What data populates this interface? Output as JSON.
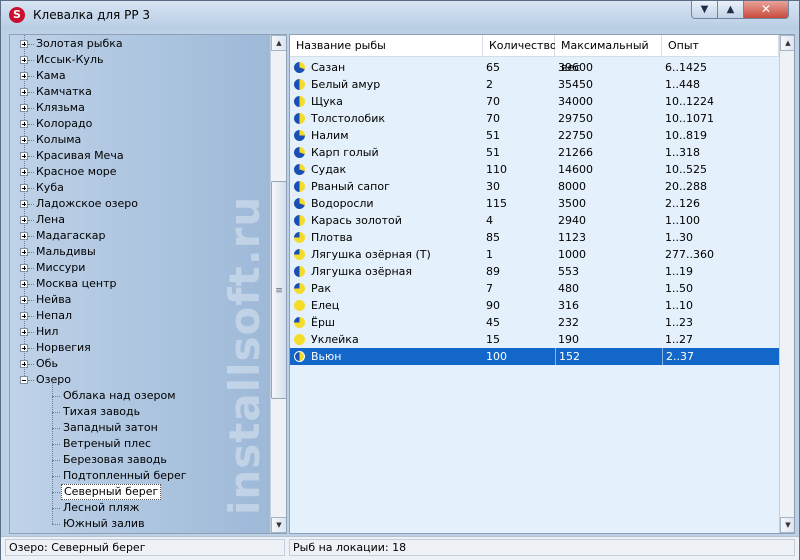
{
  "window": {
    "title": "Клевалка для РР 3",
    "app_icon_letter": "S"
  },
  "watermark": "installsoft.ru",
  "tree": {
    "lakes": [
      "Золотая рыбка",
      "Иссык-Куль",
      "Кама",
      "Камчатка",
      "Клязьма",
      "Колорадо",
      "Колыма",
      "Красивая Меча",
      "Красное море",
      "Куба",
      "Ладожское озеро",
      "Лена",
      "Мадагаскар",
      "Мальдивы",
      "Миссури",
      "Москва центр",
      "Нейва",
      "Непал",
      "Нил",
      "Норвегия",
      "Обь",
      "Озеро"
    ],
    "expanded_children": [
      "Облака над озером",
      "Тихая заводь",
      "Западный затон",
      "Ветреный плес",
      "Березовая заводь",
      "Подтопленный берег",
      "Северный берег",
      "Лесной пляж",
      "Южный залив"
    ],
    "selected": "Северный берег"
  },
  "table": {
    "columns": [
      "Название рыбы",
      "Количество",
      "Максимальный вес",
      "Опыт"
    ],
    "rows": [
      {
        "name": "Сазан",
        "count": "65",
        "max": "39600",
        "exp": "6..1425",
        "icon": "clock-3q"
      },
      {
        "name": "Белый амур",
        "count": "2",
        "max": "35450",
        "exp": "1..448",
        "icon": "clock-half"
      },
      {
        "name": "Щука",
        "count": "70",
        "max": "34000",
        "exp": "10..1224",
        "icon": "clock-half"
      },
      {
        "name": "Толстолобик",
        "count": "70",
        "max": "29750",
        "exp": "10..1071",
        "icon": "clock-half"
      },
      {
        "name": "Налим",
        "count": "51",
        "max": "22750",
        "exp": "10..819",
        "icon": "clock-full"
      },
      {
        "name": "Карп голый",
        "count": "51",
        "max": "21266",
        "exp": "1..318",
        "icon": "clock-3q"
      },
      {
        "name": "Судак",
        "count": "110",
        "max": "14600",
        "exp": "10..525",
        "icon": "clock-3q"
      },
      {
        "name": "Рваный сапог",
        "count": "30",
        "max": "8000",
        "exp": "20..288",
        "icon": "clock-half"
      },
      {
        "name": "Водоросли",
        "count": "115",
        "max": "3500",
        "exp": "2..126",
        "icon": "clock-3q"
      },
      {
        "name": "Карась золотой",
        "count": "4",
        "max": "2940",
        "exp": "1..100",
        "icon": "clock-half"
      },
      {
        "name": "Плотва",
        "count": "85",
        "max": "1123",
        "exp": "1..30",
        "icon": "clock-quarter"
      },
      {
        "name": "Лягушка озёрная (Т)",
        "count": "1",
        "max": "1000",
        "exp": "277..360",
        "icon": "clock-quarter"
      },
      {
        "name": "Лягушка озёрная",
        "count": "89",
        "max": "553",
        "exp": "1..19",
        "icon": "clock-half"
      },
      {
        "name": "Рак",
        "count": "7",
        "max": "480",
        "exp": "1..50",
        "icon": "clock-quarter"
      },
      {
        "name": "Елец",
        "count": "90",
        "max": "316",
        "exp": "1..10",
        "icon": "clock-none"
      },
      {
        "name": "Ёрш",
        "count": "45",
        "max": "232",
        "exp": "1..23",
        "icon": "clock-quarter"
      },
      {
        "name": "Уклейка",
        "count": "15",
        "max": "190",
        "exp": "1..27",
        "icon": "clock-none"
      },
      {
        "name": "Вьюн",
        "count": "100",
        "max": "152",
        "exp": "2..37",
        "icon": "clock-half"
      }
    ],
    "selected_row": "Вьюн"
  },
  "status": {
    "left": "Озеро: Северный берег",
    "right": "Рыб на локации: 18"
  },
  "colors": {
    "icon_blue": "#1a4fb5",
    "icon_yellow": "#f5dc2a",
    "selection": "#1267c8",
    "grid_bg": "#e4f0fb"
  }
}
